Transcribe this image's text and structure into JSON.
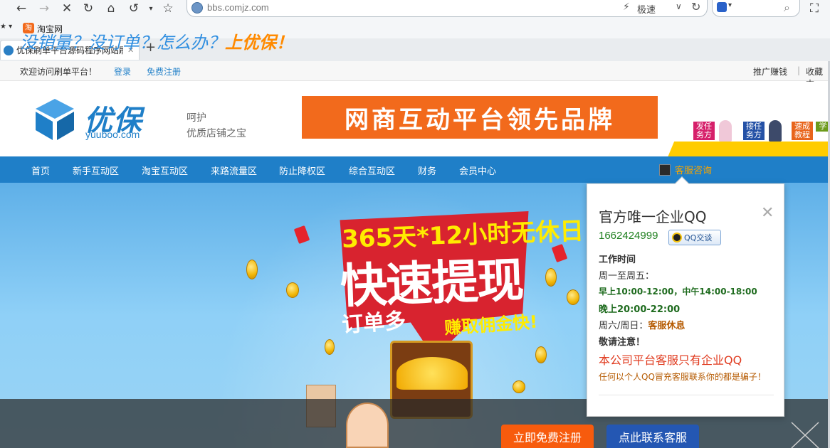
{
  "browser": {
    "url": "bbs.comjz.com",
    "speed_label": "极速",
    "bookmark": "淘宝网",
    "tab_title": "优保刷单平台源码程序网站刷"
  },
  "topbar": {
    "welcome": "欢迎访问刷单平台！",
    "login": "登录",
    "register": "免费注册",
    "promote": "推广赚钱",
    "sep": "|",
    "favorite": "收藏本"
  },
  "header": {
    "logo_text": "优保",
    "logo_sub": "yuuboo.com",
    "slogan_line1": "呵护",
    "slogan_line2": "优质店铺之宝",
    "banner": "网商互动平台领先品牌",
    "badges": [
      "发任务方",
      "接任务方",
      "速成教程",
      "学"
    ]
  },
  "nav": {
    "items": [
      "首页",
      "新手互动区",
      "淘宝互动区",
      "来路流量区",
      "防止降权区",
      "综合互动区",
      "财务",
      "会员中心"
    ],
    "service": "客服咨询"
  },
  "hero": {
    "line1": "365天*12小时无休日",
    "line2": "快速提现",
    "line3": "订单多",
    "line4": "赚取佣金快!"
  },
  "strip": {
    "text_a": "没销量？没订单？怎么办？",
    "text_b": "上优保！",
    "register_button": "立即免费注册",
    "contact_button": "点此联系客服"
  },
  "popup": {
    "title": "官方唯一企业QQ",
    "qq_number": "1662424999",
    "qq_button": "QQ交谈",
    "work_time_label": "工作时间",
    "weekdays": "周一至周五：",
    "morning": "早上10:00-12:00，中午14:00-18:00",
    "evening": "晚上20:00-22:00",
    "weekend_label": "周六/周日：",
    "weekend_value": "客服休息",
    "notice_label": "敬请注意！",
    "notice": "本公司平台客服只有企业QQ",
    "notice_detail": "任何以个人QQ冒充客服联系你的都是骗子！"
  },
  "colors": {
    "nav_blue": "#1f7fc8",
    "banner_orange": "#f26a1c",
    "register_orange": "#f75b0d",
    "contact_blue": "#2457b3"
  }
}
